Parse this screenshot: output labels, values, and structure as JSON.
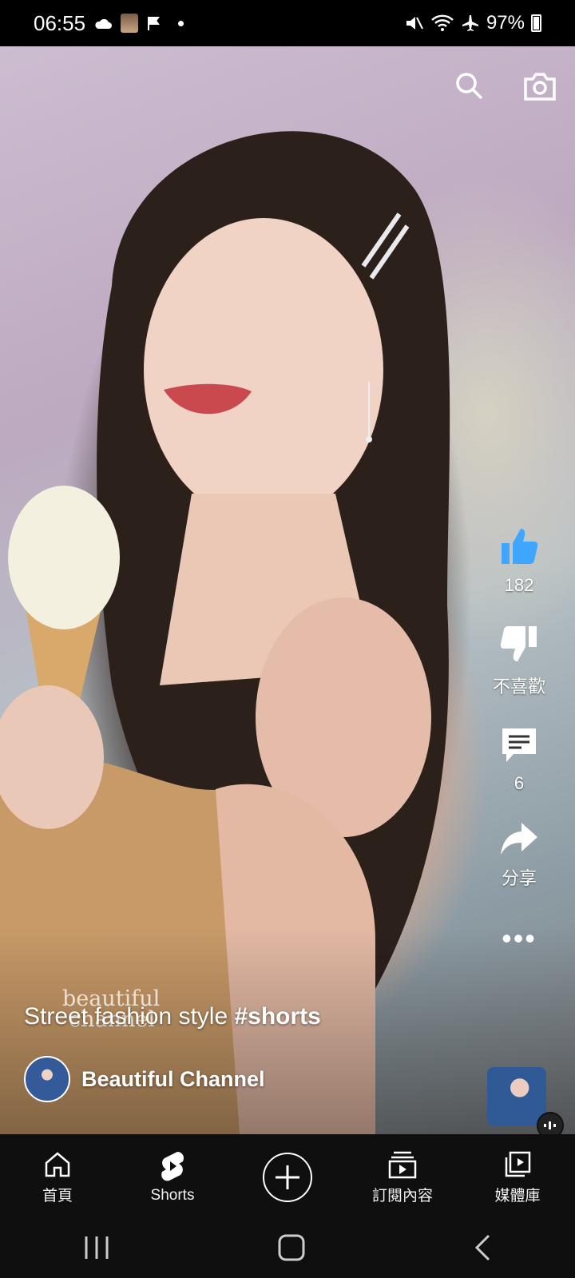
{
  "status_bar": {
    "time": "06:55",
    "battery": "97%",
    "icons": [
      "cloud-icon",
      "avatar-icon",
      "flag-icon",
      "dot-icon",
      "mute-icon",
      "wifi-icon",
      "airplane-icon",
      "battery-icon"
    ]
  },
  "video": {
    "watermark_line1": "beautiful",
    "watermark_line2": "channel",
    "caption_text": "Street fashion style ",
    "caption_tag": "#shorts",
    "channel_name": "Beautiful Channel"
  },
  "actions": {
    "like_count": "182",
    "dislike_label": "不喜歡",
    "comment_count": "6",
    "share_label": "分享",
    "more_label": "•••"
  },
  "bottom_nav": {
    "home": "首頁",
    "shorts": "Shorts",
    "subscriptions": "訂閱內容",
    "library": "媒體庫"
  },
  "colors": {
    "like_accent": "#3ea6ff",
    "nav_bg": "#0f0f0f"
  }
}
